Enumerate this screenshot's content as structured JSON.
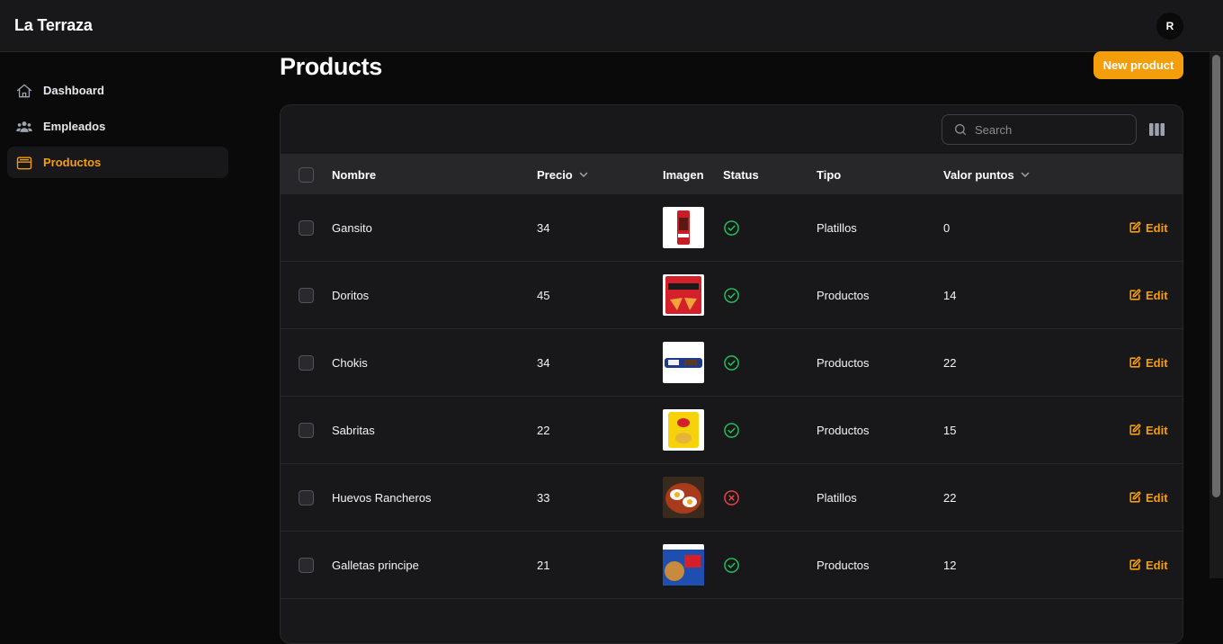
{
  "app": {
    "brand": "La Terraza",
    "avatar_initial": "R"
  },
  "sidebar": {
    "items": [
      {
        "label": "Dashboard",
        "icon": "home-icon",
        "active": false
      },
      {
        "label": "Empleados",
        "icon": "users-icon",
        "active": false
      },
      {
        "label": "Productos",
        "icon": "inbox-icon",
        "active": true
      }
    ]
  },
  "page": {
    "title": "Products",
    "new_button_label": "New product"
  },
  "search": {
    "placeholder": "Search",
    "value": ""
  },
  "table": {
    "columns": [
      "Nombre",
      "Precio",
      "Imagen",
      "Status",
      "Tipo",
      "Valor puntos"
    ],
    "sortable": [
      "Precio",
      "Valor puntos"
    ],
    "edit_label": "Edit",
    "rows": [
      {
        "nombre": "Gansito",
        "precio": "34",
        "image": "gansito-image",
        "status": "active",
        "tipo": "Platillos",
        "valor_puntos": "0"
      },
      {
        "nombre": "Doritos",
        "precio": "45",
        "image": "doritos-image",
        "status": "active",
        "tipo": "Productos",
        "valor_puntos": "14"
      },
      {
        "nombre": "Chokis",
        "precio": "34",
        "image": "chokis-image",
        "status": "active",
        "tipo": "Productos",
        "valor_puntos": "22"
      },
      {
        "nombre": "Sabritas",
        "precio": "22",
        "image": "sabritas-image",
        "status": "active",
        "tipo": "Productos",
        "valor_puntos": "15"
      },
      {
        "nombre": "Huevos Rancheros",
        "precio": "33",
        "image": "huevos-rancheros-image",
        "status": "inactive",
        "tipo": "Platillos",
        "valor_puntos": "22"
      },
      {
        "nombre": "Galletas principe",
        "precio": "21",
        "image": "galletas-principe-image",
        "status": "active",
        "tipo": "Productos",
        "valor_puntos": "12"
      }
    ]
  },
  "colors": {
    "accent": "#f59e0b",
    "status_active": "#22c55e",
    "status_inactive": "#ef4444",
    "background": "#0a0a0b",
    "surface": "#18181b"
  }
}
